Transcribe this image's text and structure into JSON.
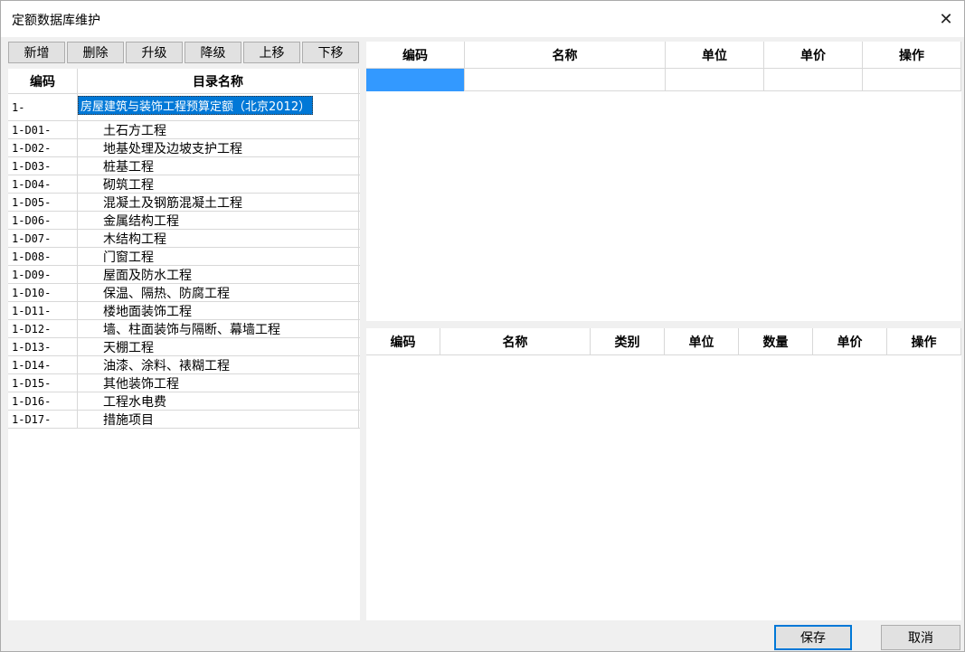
{
  "window": {
    "title": "定额数据库维护"
  },
  "toolbar": {
    "buttons": [
      "新增",
      "删除",
      "升级",
      "降级",
      "上移",
      "下移"
    ]
  },
  "tree": {
    "headers": {
      "code": "编码",
      "name": "目录名称"
    },
    "root": {
      "code": "1-",
      "name": "房屋建筑与装饰工程预算定额（北京2012）"
    },
    "items": [
      {
        "code": "1-D01-",
        "name": "土石方工程"
      },
      {
        "code": "1-D02-",
        "name": "地基处理及边坡支护工程"
      },
      {
        "code": "1-D03-",
        "name": "桩基工程"
      },
      {
        "code": "1-D04-",
        "name": "砌筑工程"
      },
      {
        "code": "1-D05-",
        "name": "混凝土及钢筋混凝土工程"
      },
      {
        "code": "1-D06-",
        "name": "金属结构工程"
      },
      {
        "code": "1-D07-",
        "name": "木结构工程"
      },
      {
        "code": "1-D08-",
        "name": "门窗工程"
      },
      {
        "code": "1-D09-",
        "name": "屋面及防水工程"
      },
      {
        "code": "1-D10-",
        "name": "保温、隔热、防腐工程"
      },
      {
        "code": "1-D11-",
        "name": "楼地面装饰工程"
      },
      {
        "code": "1-D12-",
        "name": "墙、柱面装饰与隔断、幕墙工程"
      },
      {
        "code": "1-D13-",
        "name": "天棚工程"
      },
      {
        "code": "1-D14-",
        "name": "油漆、涂料、裱糊工程"
      },
      {
        "code": "1-D15-",
        "name": "其他装饰工程"
      },
      {
        "code": "1-D16-",
        "name": "工程水电费"
      },
      {
        "code": "1-D17-",
        "name": "措施项目"
      }
    ]
  },
  "quota_table": {
    "headers": [
      "编码",
      "名称",
      "单位",
      "单价",
      "操作"
    ]
  },
  "resource_table": {
    "headers": [
      "编码",
      "名称",
      "类别",
      "单位",
      "数量",
      "单价",
      "操作"
    ]
  },
  "footer": {
    "save": "保存",
    "cancel": "取消"
  },
  "colors": {
    "selection": "#0078d7",
    "selected_cell": "#3399ff"
  }
}
